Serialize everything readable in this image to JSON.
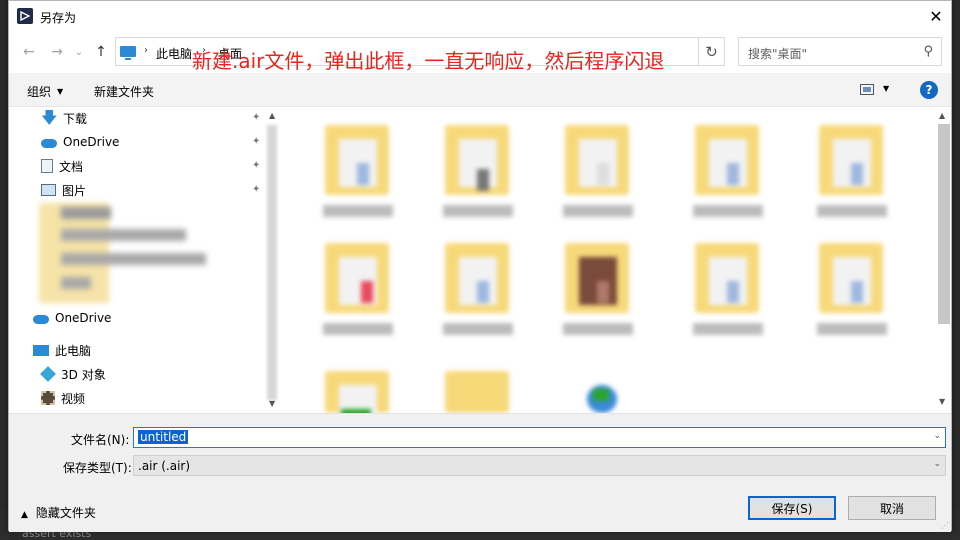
{
  "background": {
    "text": "assert exists"
  },
  "dialog": {
    "title": "另存为",
    "close_glyph": "✕"
  },
  "nav": {
    "back_glyph": "←",
    "forward_glyph": "→",
    "recent_glyph": "⌄",
    "up_glyph": "↑",
    "breadcrumb": [
      "此电脑",
      "桌面"
    ],
    "breadcrumb_sep": "›",
    "dropdown_glyph": "⌄",
    "refresh_glyph": "↻",
    "search_placeholder": "搜索\"桌面\"",
    "search_glyph": "⚲"
  },
  "annotation": {
    "text": "新建.air文件，弹出此框，一直无响应，然后程序闪退",
    "color": "#e8251f"
  },
  "toolbar": {
    "organize_label": "组织",
    "organize_caret": "▼",
    "new_folder_label": "新建文件夹",
    "view_caret": "▼",
    "help_label": "?"
  },
  "sidebar": {
    "items": [
      {
        "label": "下载",
        "icon": "download-icon",
        "pinned": true
      },
      {
        "label": "OneDrive",
        "icon": "cloud-icon",
        "pinned": true
      },
      {
        "label": "文档",
        "icon": "document-icon",
        "pinned": true
      },
      {
        "label": "图片",
        "icon": "picture-icon",
        "pinned": true
      },
      {
        "label": "OneDrive",
        "icon": "cloud-icon"
      },
      {
        "label": "此电脑",
        "icon": "computer-icon"
      },
      {
        "label": "3D 对象",
        "icon": "cube-icon"
      },
      {
        "label": "视频",
        "icon": "video-icon"
      }
    ],
    "pin_glyph": "📌",
    "scroll_up": "▲",
    "scroll_down": "▼"
  },
  "filepane": {
    "scroll_up": "▲",
    "scroll_down": "▼"
  },
  "fields": {
    "filename_label": "文件名(N):",
    "filename_value": "untitled",
    "filetype_label": "保存类型(T):",
    "filetype_value": ".air (.air)",
    "caret": "⌄"
  },
  "footer": {
    "hide_folders_label": "隐藏文件夹",
    "hide_folders_chevron": "▲",
    "save_label": "保存(S)",
    "cancel_label": "取消"
  },
  "colors": {
    "accent": "#0a64d6",
    "folder": "#f7d97a",
    "help": "#1368c4"
  }
}
